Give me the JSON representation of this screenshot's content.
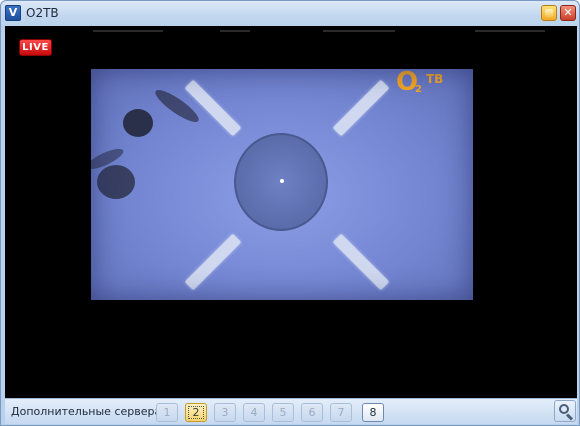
{
  "window": {
    "title": "O2TB",
    "app_icon_glyph": "V"
  },
  "title_buttons": {
    "minimize_icon": "minimize-icon",
    "close_icon": "close-icon",
    "close_glyph": "✕"
  },
  "video": {
    "live_badge": "LIVE",
    "channel_logo": {
      "main": "O",
      "sub": "2",
      "suffix": "ТВ"
    }
  },
  "statusbar": {
    "label": "Дополнительные сервера",
    "servers": [
      "1",
      "2",
      "3",
      "4",
      "5",
      "6",
      "7",
      "8"
    ],
    "selected_server": "2",
    "active_server": "8",
    "search_icon": "magnifier-icon"
  },
  "colors": {
    "live_red": "#d71414",
    "logo_orange": "#f5a623",
    "window_frame": "#b9d1ea"
  }
}
